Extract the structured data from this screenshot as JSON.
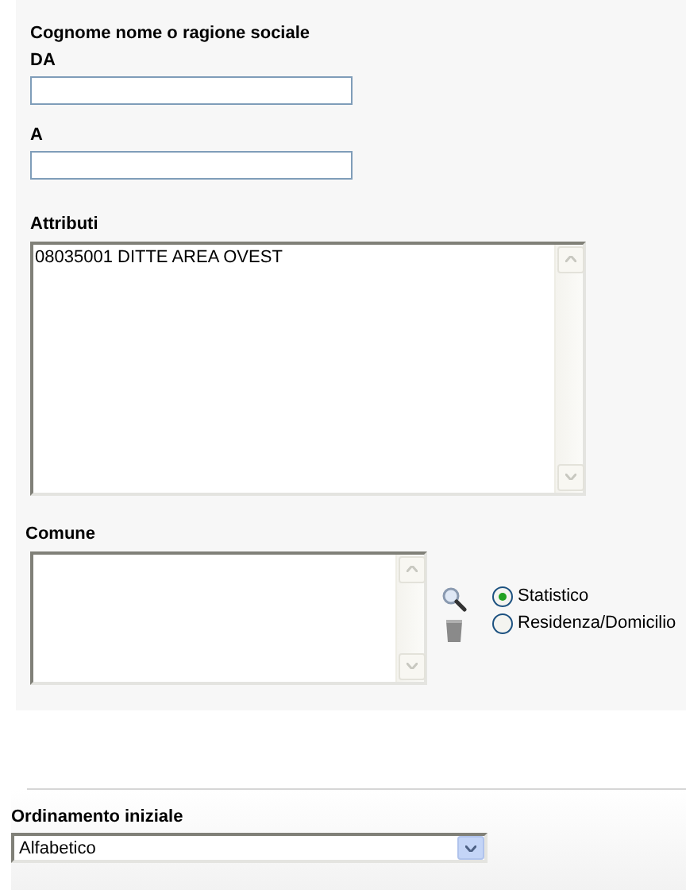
{
  "name_range": {
    "title": "Cognome nome o ragione sociale",
    "from": {
      "label": "DA"
    },
    "to": {
      "label": "A"
    }
  },
  "attributes": {
    "label": "Attributi",
    "items": [
      "08035001 DITTE AREA OVEST"
    ]
  },
  "comune": {
    "label": "Comune",
    "options": [
      {
        "label": "Statistico",
        "selected": true
      },
      {
        "label": "Residenza/Domicilio",
        "selected": false
      }
    ]
  },
  "ordering": {
    "label": "Ordinamento iniziale",
    "value": "Alfabetico"
  }
}
